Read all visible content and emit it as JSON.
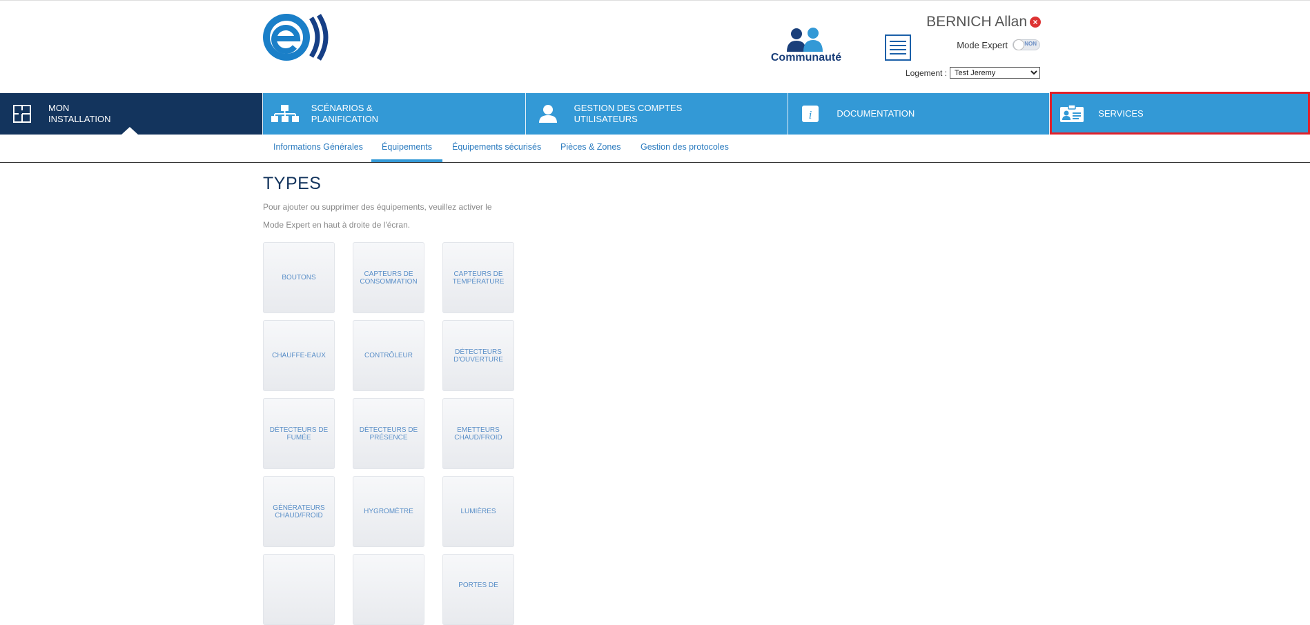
{
  "header": {
    "user_name": "BERNICH Allan",
    "communaute_label": "Communauté",
    "mode_expert_label": "Mode Expert",
    "mode_expert_toggle": "NON",
    "logement_label": "Logement :",
    "logement_value": "Test Jeremy"
  },
  "nav": {
    "items": [
      {
        "label": "MON\nINSTALLATION"
      },
      {
        "label": "SCÉNARIOS &\nPLANIFICATION"
      },
      {
        "label": "GESTION DES COMPTES\nUTILISATEURS"
      },
      {
        "label": "DOCUMENTATION"
      },
      {
        "label": "SERVICES"
      }
    ]
  },
  "subnav": {
    "tabs": [
      {
        "label": "Informations Générales"
      },
      {
        "label": "Équipements"
      },
      {
        "label": "Équipements sécurisés"
      },
      {
        "label": "Pièces & Zones"
      },
      {
        "label": "Gestion des protocoles"
      }
    ]
  },
  "content": {
    "title": "TYPES",
    "description": "Pour ajouter ou supprimer des équipements, veuillez activer le Mode Expert en haut à droite de l'écran."
  },
  "tiles": [
    "BOUTONS",
    "CAPTEURS DE CONSOMMATION",
    "CAPTEURS DE TEMPÉRATURE",
    "CHAUFFE-EAUX",
    "CONTRÔLEUR",
    "DÉTECTEURS D'OUVERTURE",
    "DÉTECTEURS DE FUMÉE",
    "DÉTECTEURS DE PRÉSENCE",
    "EMETTEURS CHAUD/FROID",
    "GÉNÉRATEURS CHAUD/FROID",
    "HYGROMÈTRE",
    "LUMIÈRES",
    "",
    "",
    "PORTES DE"
  ],
  "colors": {
    "nav_blue": "#3399d6",
    "nav_active": "#13345d",
    "highlight": "#e0202a"
  }
}
